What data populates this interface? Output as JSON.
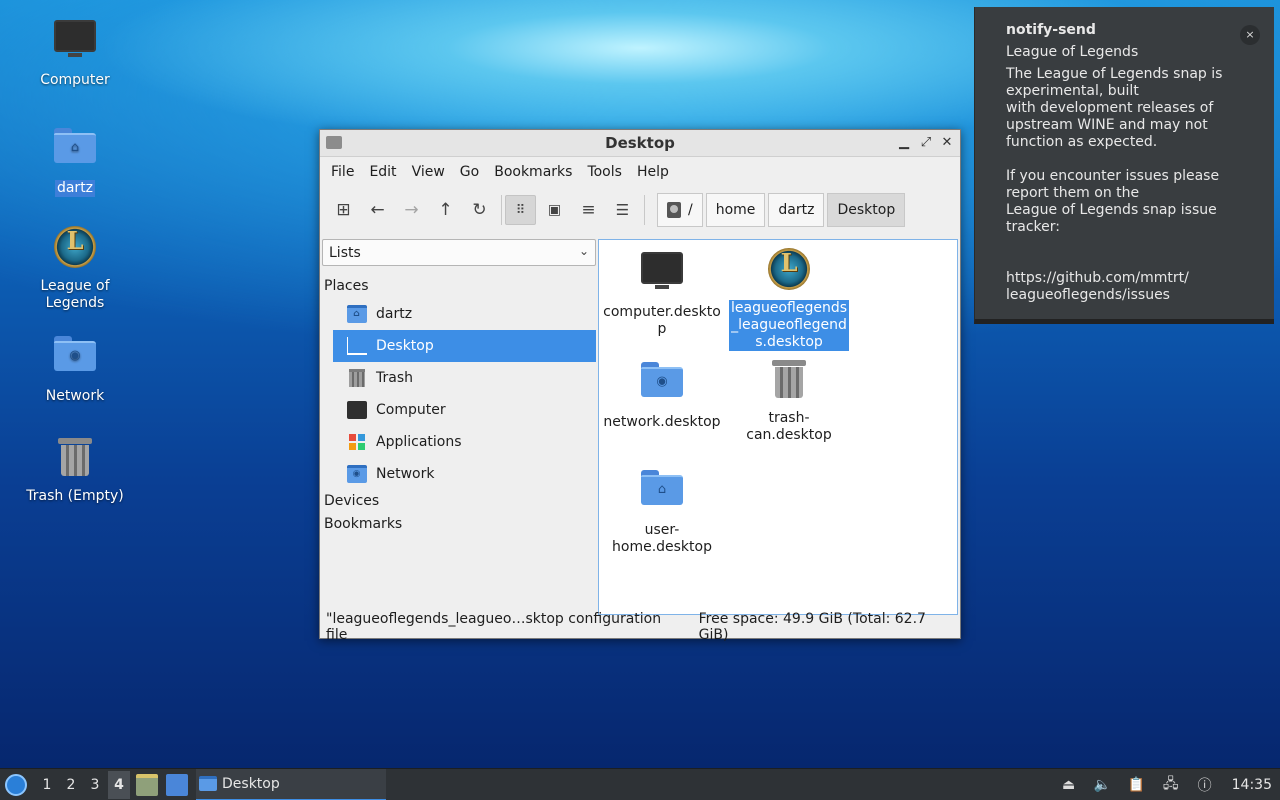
{
  "desktop": {
    "icons": [
      {
        "label": "Computer",
        "icon": "computer-icon"
      },
      {
        "label": "dartz",
        "icon": "home-folder-icon"
      },
      {
        "label": "League of Legends",
        "icon": "league-of-legends-icon"
      },
      {
        "label": "Network",
        "icon": "network-folder-icon"
      },
      {
        "label": "Trash (Empty)",
        "icon": "trash-icon"
      }
    ]
  },
  "window": {
    "title": "Desktop",
    "menu": [
      "File",
      "Edit",
      "View",
      "Go",
      "Bookmarks",
      "Tools",
      "Help"
    ],
    "path": {
      "root": "/",
      "crumbs": [
        "home",
        "dartz",
        "Desktop"
      ]
    },
    "side": {
      "mode": "Lists",
      "places_label": "Places",
      "places": [
        "dartz",
        "Desktop",
        "Trash",
        "Computer",
        "Applications",
        "Network"
      ],
      "devices_label": "Devices",
      "bookmarks_label": "Bookmarks"
    },
    "files": [
      {
        "name": "computer.desktop",
        "icon": "computer-icon"
      },
      {
        "name": "leagueoflegends_leagueoflegends.desktop",
        "icon": "league-of-legends-icon",
        "selected": true
      },
      {
        "name": "network.desktop",
        "icon": "network-folder-icon"
      },
      {
        "name": "trash-can.desktop",
        "icon": "trash-icon"
      },
      {
        "name": "user-home.desktop",
        "icon": "home-folder-icon"
      }
    ],
    "status": {
      "selection": "\"leagueoflegends_leagueo…sktop configuration file",
      "free": "Free space: 49.9 GiB (Total: 62.7 GiB)"
    }
  },
  "notification": {
    "app": "notify-send",
    "summary": "League of Legends",
    "body": "The League of Legends snap is experimental, built\nwith development releases of upstream WINE and may not function as expected.\n\nIf you encounter issues please report them on the\nLeague of Legends snap issue tracker:\n\n\nhttps://github.com/mmtrt/\nleagueoflegends/issues",
    "close": "×"
  },
  "taskbar": {
    "workspaces": [
      "1",
      "2",
      "3",
      "4"
    ],
    "active_workspace": "4",
    "task_label": "Desktop",
    "clock": "14:35"
  },
  "colors": {
    "selection": "#3d8ee6",
    "taskbar": "#2e3236",
    "notification": "#393d40"
  }
}
